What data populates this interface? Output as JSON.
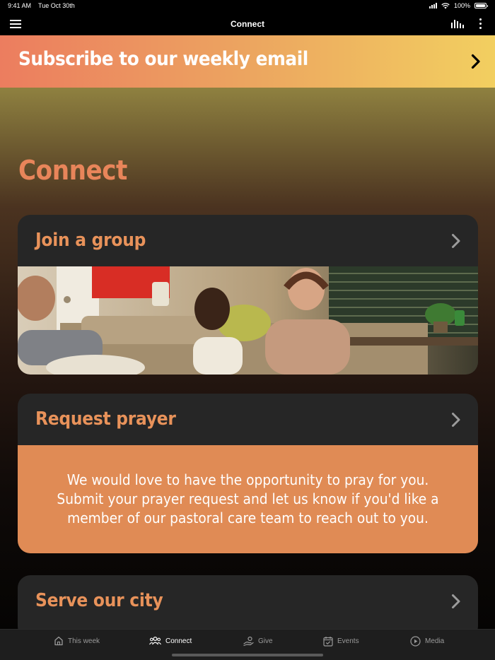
{
  "status_bar": {
    "time": "9:41 AM",
    "date": "Tue Oct 30th",
    "battery": "100%"
  },
  "nav": {
    "title": "Connect",
    "menu_icon": "hamburger-icon",
    "audio_icon": "audio-bars-icon",
    "more_icon": "more-vertical-icon"
  },
  "banner": {
    "text": "Subscribe to our weekly email",
    "icon": "chevron-right-icon"
  },
  "page": {
    "heading": "Connect",
    "accent_color": "#e8855a"
  },
  "cards": [
    {
      "title": "Join a group",
      "icon": "chevron-right-icon"
    },
    {
      "title": "Request prayer",
      "icon": "chevron-right-icon",
      "body": "We would love to have the opportunity to pray for you. Submit your prayer request and let us know if you'd like a member of our pastoral care team to reach out to you."
    },
    {
      "title": "Serve our city",
      "icon": "chevron-right-icon"
    }
  ],
  "tabs": [
    {
      "label": "This week",
      "icon": "home-icon",
      "active": false
    },
    {
      "label": "Connect",
      "icon": "people-icon",
      "active": true
    },
    {
      "label": "Give",
      "icon": "give-hand-icon",
      "active": false
    },
    {
      "label": "Events",
      "icon": "calendar-icon",
      "active": false
    },
    {
      "label": "Media",
      "icon": "play-circle-icon",
      "active": false
    }
  ]
}
